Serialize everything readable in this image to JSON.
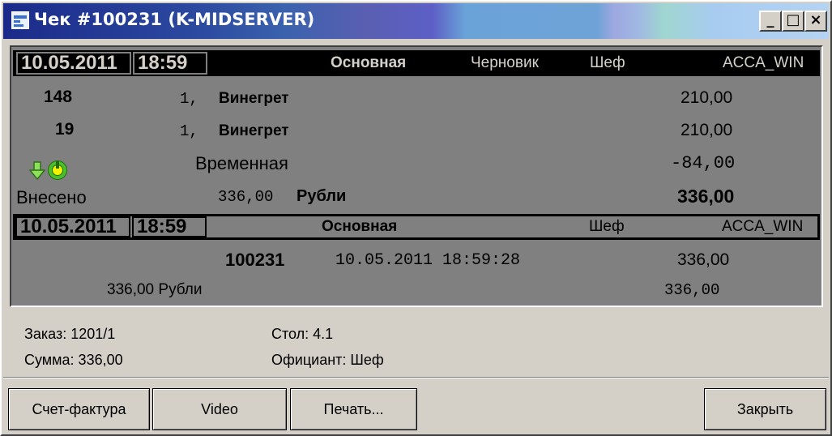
{
  "window": {
    "title": "Чек #100231 (K-MIDSERVER)",
    "controls": {
      "minimize": "_",
      "maximize": "□",
      "close": "×"
    }
  },
  "receipt": {
    "header1": {
      "date": "10.05.2011",
      "time": "18:59",
      "section": "Основная",
      "state": "Черновик",
      "waiter": "Шеф",
      "host": "ACCA_WIN"
    },
    "items": [
      {
        "code": "148",
        "qty": "1,",
        "name": "Винегрет",
        "amount": "210,00"
      },
      {
        "code": "19",
        "qty": "1,",
        "name": "Винегрет",
        "amount": "210,00"
      }
    ],
    "discount": {
      "name": "Временная",
      "amount": "-84,00"
    },
    "payment": {
      "label": "Внесено",
      "value": "336,00",
      "currency": "Рубли",
      "total": "336,00"
    },
    "header2": {
      "date": "10.05.2011",
      "time": "18:59",
      "section": "Основная",
      "waiter": "Шеф",
      "host": "ACCA_WIN"
    },
    "check": {
      "number": "100231",
      "datetime": "10.05.2011 18:59:28",
      "amount": "336,00"
    },
    "footer": {
      "value": "336,00 Рубли",
      "total": "336,00"
    }
  },
  "info": {
    "order": "Заказ: 1201/1",
    "sum": "Сумма: 336,00",
    "table": "Стол: 4.1",
    "waiter": "Официант: Шеф"
  },
  "buttons": {
    "invoice": "Счет-фактура",
    "video": "Video",
    "print": "Печать...",
    "close": "Закрыть"
  },
  "colors": {
    "window_bg": "#d4d0c8",
    "content_bg": "#808080",
    "header_bg": "#000000",
    "title_text": "#ffffff"
  },
  "icons": [
    "document-icon",
    "arrow-down-icon",
    "power-icon",
    "minimize-icon",
    "maximize-icon",
    "close-icon"
  ]
}
